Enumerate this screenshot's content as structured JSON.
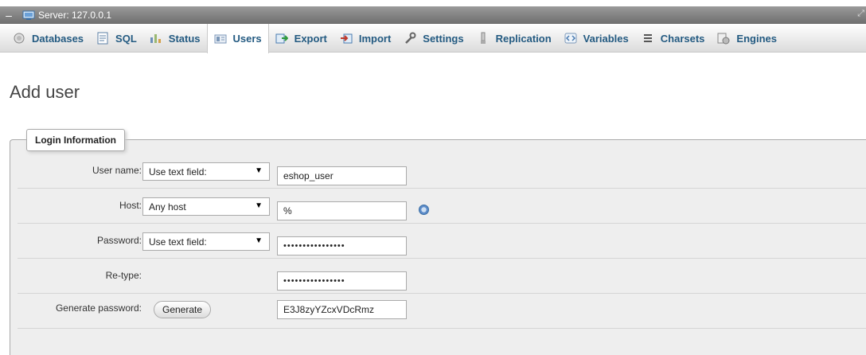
{
  "server": {
    "label": "Server: 127.0.0.1"
  },
  "tabs": [
    {
      "label": "Databases",
      "icon": "database-icon"
    },
    {
      "label": "SQL",
      "icon": "sql-icon"
    },
    {
      "label": "Status",
      "icon": "status-icon"
    },
    {
      "label": "Users",
      "icon": "users-icon",
      "active": true
    },
    {
      "label": "Export",
      "icon": "export-icon"
    },
    {
      "label": "Import",
      "icon": "import-icon"
    },
    {
      "label": "Settings",
      "icon": "wrench-icon"
    },
    {
      "label": "Replication",
      "icon": "replication-icon"
    },
    {
      "label": "Variables",
      "icon": "variables-icon"
    },
    {
      "label": "Charsets",
      "icon": "charsets-icon"
    },
    {
      "label": "Engines",
      "icon": "engines-icon"
    }
  ],
  "page": {
    "title": "Add user"
  },
  "login": {
    "legend": "Login Information",
    "username": {
      "label": "User name:",
      "select": "Use text field:",
      "value": "eshop_user"
    },
    "host": {
      "label": "Host:",
      "select": "Any host",
      "value": "%"
    },
    "password": {
      "label": "Password:",
      "select": "Use text field:",
      "value": "••••••••••••••••"
    },
    "retype": {
      "label": "Re-type:",
      "value": "••••••••••••••••"
    },
    "generate": {
      "label": "Generate password:",
      "button": "Generate",
      "value": "E3J8zyYZcxVDcRmz"
    }
  },
  "colors": {
    "tab_text": "#235a81",
    "server_bar": "#7d7d7d",
    "fieldset_bg": "#eeeeee"
  }
}
